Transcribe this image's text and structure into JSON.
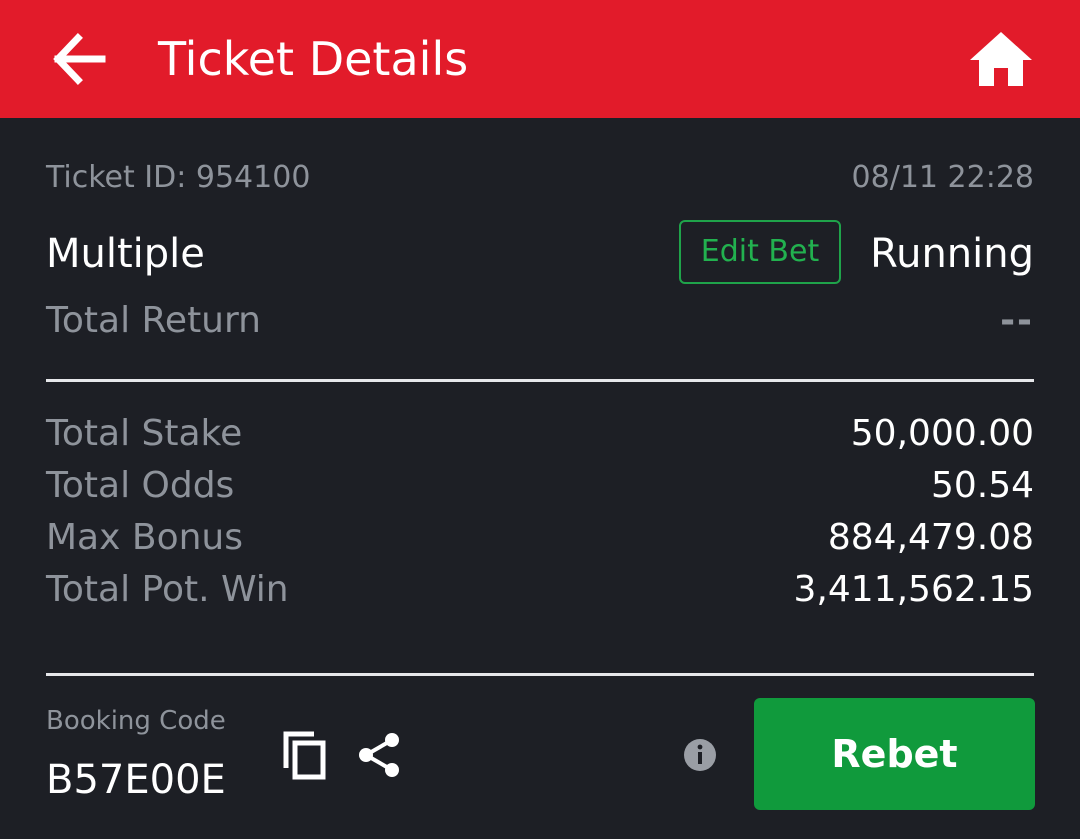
{
  "header": {
    "title": "Ticket Details",
    "back_icon": "arrow-left-icon",
    "home_icon": "home-icon",
    "background": "#e21b2a"
  },
  "ticket": {
    "id_text": "Ticket ID: 954100",
    "datetime": "08/11 22:28",
    "bet_type": "Multiple",
    "edit_bet_label": "Edit Bet",
    "status": "Running",
    "total_return_label": "Total Return",
    "total_return_value": "--"
  },
  "summary": [
    {
      "label": "Total Stake",
      "value": "50,000.00"
    },
    {
      "label": "Total Odds",
      "value": "50.54"
    },
    {
      "label": "Max Bonus",
      "value": "884,479.08"
    },
    {
      "label": "Total Pot. Win",
      "value": "3,411,562.15"
    }
  ],
  "booking": {
    "label": "Booking Code",
    "code": "B57E00E",
    "copy_icon": "copy-icon",
    "share_icon": "share-icon",
    "info_icon": "info-icon"
  },
  "rebet_label": "Rebet",
  "colors": {
    "background": "#1d1f25",
    "accent_green": "#22b14f",
    "button_green": "#109a3c",
    "muted_text": "#8e939b"
  }
}
